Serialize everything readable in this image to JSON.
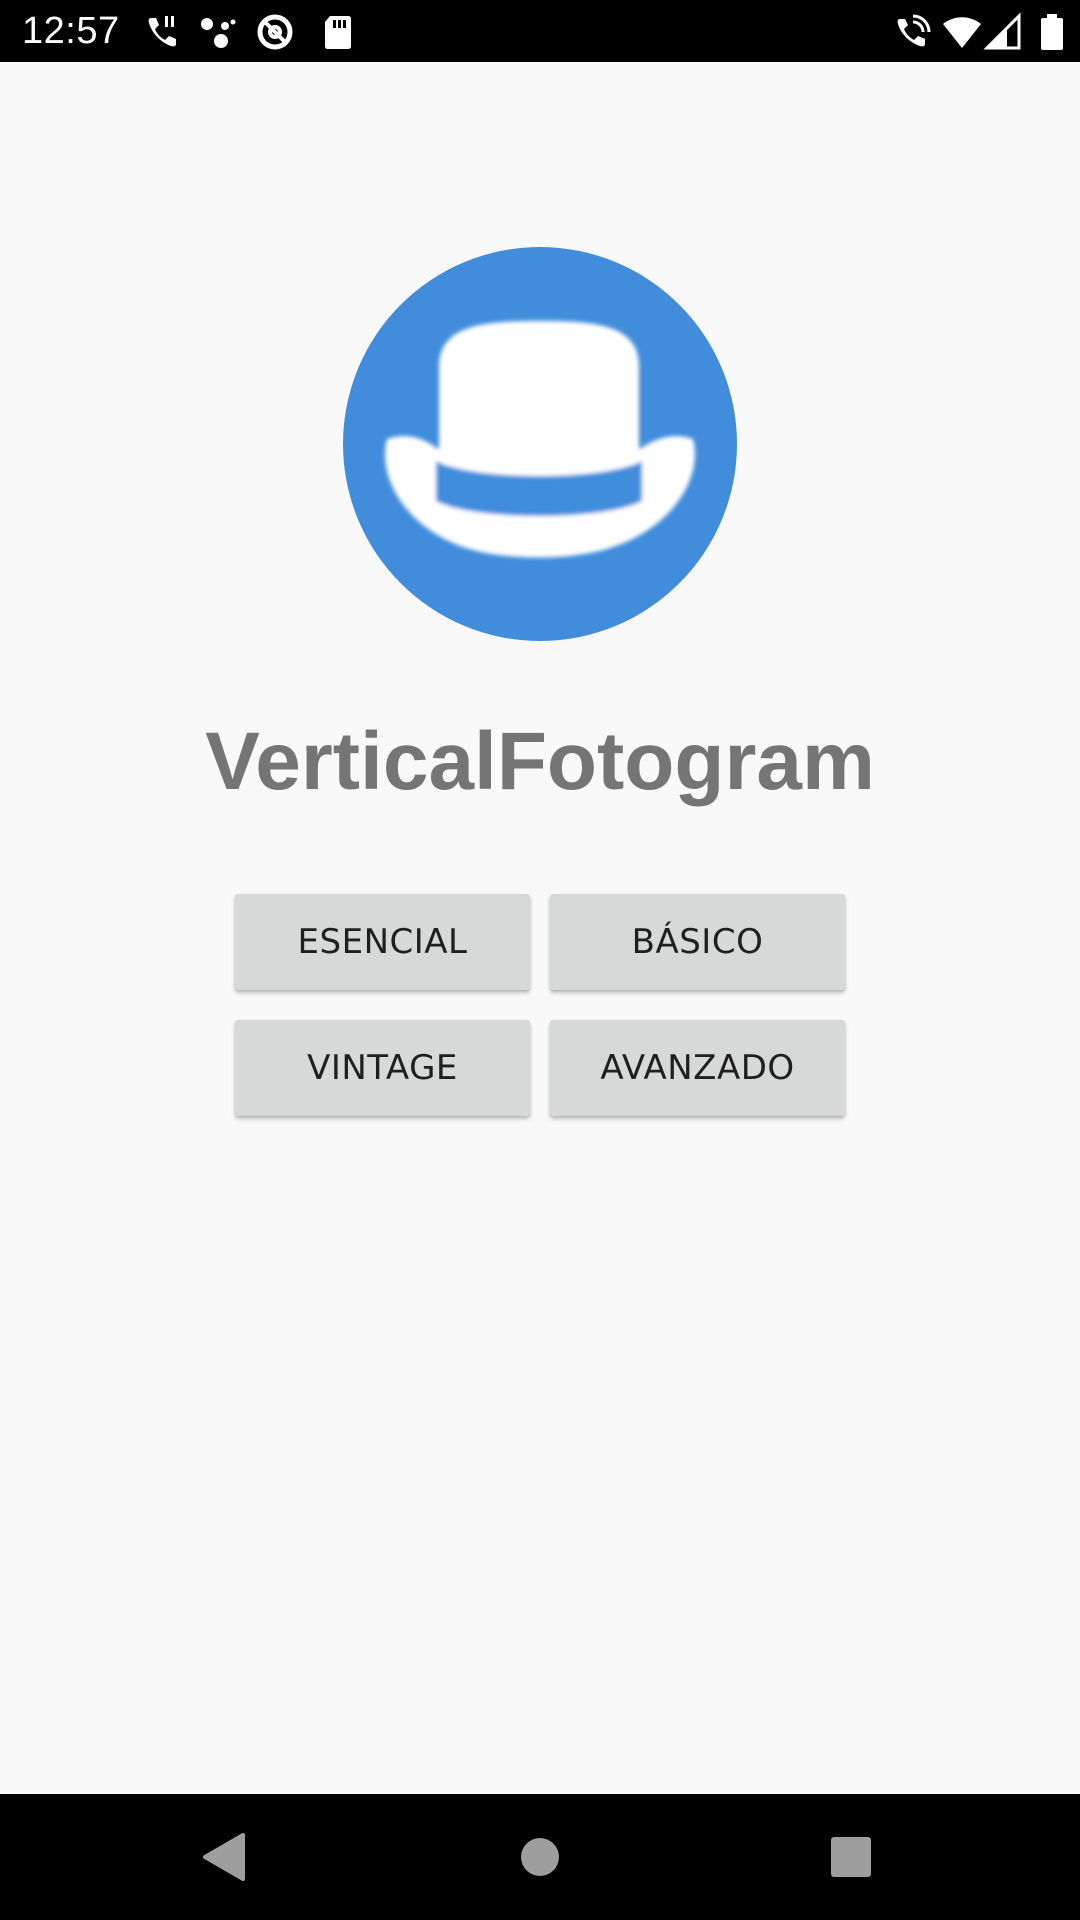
{
  "status_bar": {
    "time": "12:57",
    "left_icons": [
      "phone-call-icon",
      "assistant-dots-icon",
      "data-saver-icon",
      "sd-card-icon"
    ],
    "right_icons": [
      "wifi-calling-icon",
      "wifi-icon",
      "signal-icon",
      "battery-icon"
    ]
  },
  "app": {
    "title": "VerticalFotogram",
    "logo_icon": "bowler-hat-icon",
    "logo_color": "#418ddc"
  },
  "buttons": {
    "esencial": "ESENCIAL",
    "basico": "BÁSICO",
    "vintage": "VINTAGE",
    "avanzado": "AVANZADO"
  },
  "nav_bar": {
    "icons": [
      "back-icon",
      "home-icon",
      "recents-icon"
    ]
  }
}
